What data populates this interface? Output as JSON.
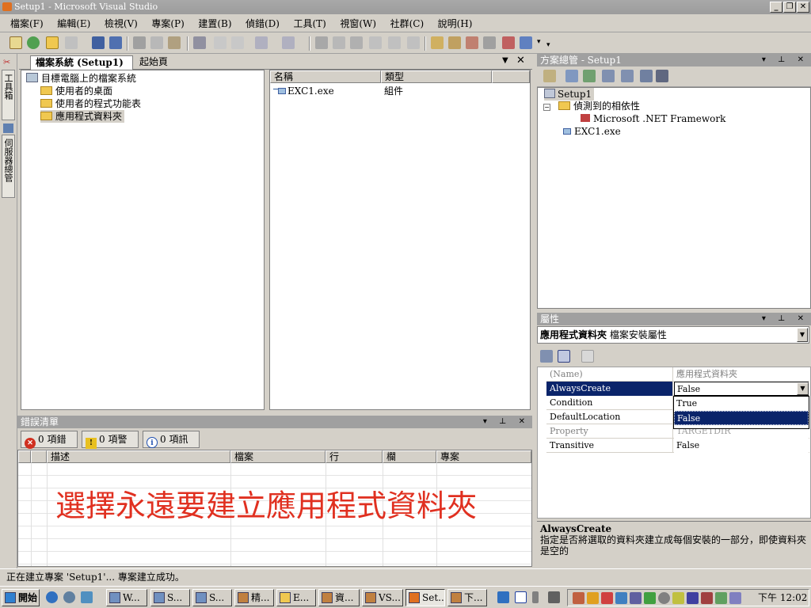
{
  "window": {
    "title": "Setup1 - Microsoft Visual Studio",
    "min": "_",
    "max": "❐",
    "close": "✕"
  },
  "menu": [
    "檔案(F)",
    "編輯(E)",
    "檢視(V)",
    "專案(P)",
    "建置(B)",
    "偵錯(D)",
    "工具(T)",
    "視窗(W)",
    "社群(C)",
    "說明(H)"
  ],
  "left_strip": {
    "toolbox": "工具箱",
    "server_explorer": "伺服器總管"
  },
  "doc_tabs": [
    {
      "label": "檔案系統 (Setup1)",
      "active": true
    },
    {
      "label": "起始頁",
      "active": false
    }
  ],
  "fs_tree": {
    "root": "目標電腦上的檔案系統",
    "folders": [
      "使用者的桌面",
      "使用者的程式功能表",
      "應用程式資料夾"
    ],
    "selected": "應用程式資料夾"
  },
  "fs_list": {
    "columns": [
      "名稱",
      "類型"
    ],
    "rows": [
      {
        "name": "EXC1.exe",
        "type": "組件"
      }
    ]
  },
  "solution_explorer": {
    "title": "方案總管 - Setup1",
    "project": "Setup1",
    "deps_folder": "偵測到的相依性",
    "dep": "Microsoft .NET Framework",
    "output": "EXC1.exe"
  },
  "properties": {
    "title": "屬性",
    "object": "應用程式資料夾",
    "object_type": "檔案安裝屬性",
    "rows": [
      {
        "name": "(Name)",
        "value": "應用程式資料夾",
        "grey": true
      },
      {
        "name": "AlwaysCreate",
        "value": "False",
        "selected": true
      },
      {
        "name": "Condition",
        "value": ""
      },
      {
        "name": "DefaultLocation",
        "value": ""
      },
      {
        "name": "Property",
        "value": "TARGETDIR",
        "grey": true
      },
      {
        "name": "Transitive",
        "value": "False"
      }
    ],
    "dropdown_options": [
      "True",
      "False"
    ],
    "dropdown_selected": "False",
    "desc_title": "AlwaysCreate",
    "desc_text": "指定是否將選取的資料夾建立成每個安裝的一部分，即使資料夾是空的"
  },
  "error_list": {
    "title": "錯誤清單",
    "errors": "0 項錯誤",
    "warnings": "0 項警告",
    "messages": "0 項訊息",
    "columns": [
      "描述",
      "檔案",
      "行",
      "欄",
      "專案"
    ]
  },
  "overlay_caption": "選擇永遠要建立應用程式資料夾",
  "status": "正在建立專案 'Setup1'... 專案建立成功。",
  "taskbar": {
    "start": "開始",
    "tasks": [
      "W...",
      "S...",
      "S...",
      "精...",
      "E...",
      "資...",
      "VS...",
      "Set...",
      "下..."
    ],
    "clock": "下午 12:02"
  },
  "colors": {
    "selection": "#0a246a",
    "caption": "#e03020",
    "panel_title": "#a0a0a0"
  }
}
